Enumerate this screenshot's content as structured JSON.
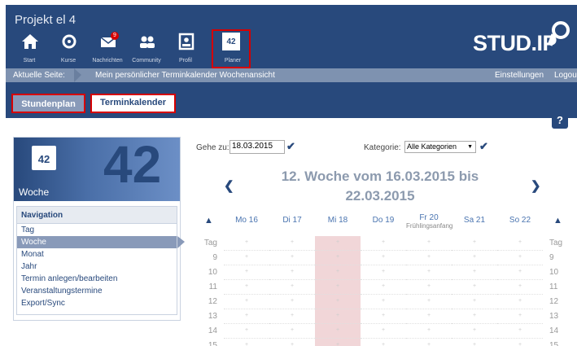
{
  "project_title": "Projekt el 4",
  "nav": [
    {
      "label": "Start",
      "icon": "home-icon"
    },
    {
      "label": "Kurse",
      "icon": "courses-icon"
    },
    {
      "label": "Nachrichten",
      "icon": "mail-icon",
      "badge": "9"
    },
    {
      "label": "Community",
      "icon": "community-icon"
    },
    {
      "label": "Profil",
      "icon": "profile-icon"
    },
    {
      "label": "Planer",
      "icon": "calendar-icon",
      "icon_text": "42"
    }
  ],
  "logo_text": "STUD.IP",
  "breadcrumb": {
    "label": "Aktuelle Seite:",
    "path": "Mein persönlicher Terminkalender  Wochenansicht",
    "settings": "Einstellungen",
    "logout": "Logou"
  },
  "tabs": {
    "stundenplan": "Stundenplan",
    "terminkalender": "Terminkalender"
  },
  "help": "?",
  "sidebar": {
    "big_number": "42",
    "icon_number": "42",
    "title": "Woche",
    "nav_heading": "Navigation",
    "links": [
      "Tag",
      "Woche",
      "Monat",
      "Jahr",
      "Termin anlegen/bearbeiten",
      "Veranstaltungstermine",
      "Export/Sync"
    ]
  },
  "goto": {
    "label": "Gehe zu:",
    "value": "18.03.2015"
  },
  "kategorie": {
    "label": "Kategorie:",
    "value": "Alle Kategorien"
  },
  "week_title": "12. Woche vom 16.03.2015 bis 22.03.2015",
  "days": [
    {
      "label": "Mo 16"
    },
    {
      "label": "Di 17"
    },
    {
      "label": "Mi 18"
    },
    {
      "label": "Do 19"
    },
    {
      "label": "Fr 20",
      "holiday": "Frühlingsanfang"
    },
    {
      "label": "Sa 21"
    },
    {
      "label": "So 22"
    }
  ],
  "hours": [
    "Tag",
    "9",
    "10",
    "11",
    "12",
    "13",
    "14",
    "15"
  ],
  "colors": {
    "primary": "#28497c",
    "today": "#f1d6d8",
    "highlight": "#d60000"
  }
}
